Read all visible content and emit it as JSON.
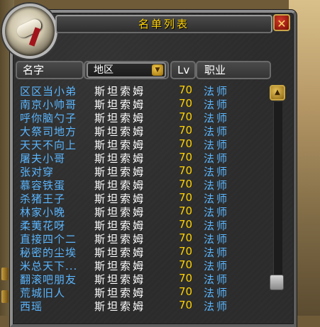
{
  "window": {
    "title": "名单列表",
    "close_label": "✕"
  },
  "header": {
    "name_label": "名字",
    "zone_label": "地区",
    "zone_arrow": "▼",
    "level_label": "Lv",
    "class_label": "职业"
  },
  "scroll": {
    "up_arrow": "▲"
  },
  "rows": [
    {
      "name": "区区当小弟",
      "zone": "斯坦索姆",
      "level": "70",
      "class": "法师"
    },
    {
      "name": "南京小帅哥",
      "zone": "斯坦索姆",
      "level": "70",
      "class": "法师"
    },
    {
      "name": "呼你脑勺子",
      "zone": "斯坦索姆",
      "level": "70",
      "class": "法师"
    },
    {
      "name": "大祭司地方",
      "zone": "斯坦索姆",
      "level": "70",
      "class": "法师"
    },
    {
      "name": "天天不向上",
      "zone": "斯坦索姆",
      "level": "70",
      "class": "法师"
    },
    {
      "name": "屠夫小哥",
      "zone": "斯坦索姆",
      "level": "70",
      "class": "法师"
    },
    {
      "name": "张对穿",
      "zone": "斯坦索姆",
      "level": "70",
      "class": "法师"
    },
    {
      "name": "慕容铁蛋",
      "zone": "斯坦索姆",
      "level": "70",
      "class": "法师"
    },
    {
      "name": "杀猪王子",
      "zone": "斯坦索姆",
      "level": "70",
      "class": "法师"
    },
    {
      "name": "林家小晚",
      "zone": "斯坦索姆",
      "level": "70",
      "class": "法师"
    },
    {
      "name": "柔荑花呀",
      "zone": "斯坦索姆",
      "level": "70",
      "class": "法师"
    },
    {
      "name": "直接四个二",
      "zone": "斯坦索姆",
      "level": "70",
      "class": "法师"
    },
    {
      "name": "秘密的尘埃",
      "zone": "斯坦索姆",
      "level": "70",
      "class": "法师"
    },
    {
      "name": "米总天下...",
      "zone": "斯坦索姆",
      "level": "70",
      "class": "法师"
    },
    {
      "name": "翻滚吧朋友",
      "zone": "斯坦索姆",
      "level": "70",
      "class": "法师"
    },
    {
      "name": "荒城旧人",
      "zone": "斯坦索姆",
      "level": "70",
      "class": "法师"
    },
    {
      "name": "西瑶",
      "zone": "斯坦索姆",
      "level": "70",
      "class": "法师"
    }
  ]
}
